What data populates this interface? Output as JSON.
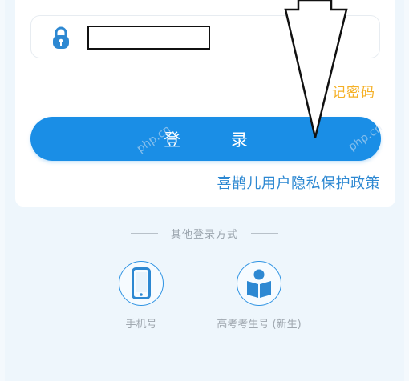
{
  "login_form": {
    "password_value": "",
    "forgot_password_label": "记密码",
    "login_button_label": "登 录",
    "privacy_link_label": "喜鹊儿用户隐私保护政策"
  },
  "other_login": {
    "divider_label": "其他登录方式",
    "methods": [
      {
        "label": "手机号",
        "icon": "phone-icon"
      },
      {
        "label": "高考考生号 (新生)",
        "icon": "reading-person-icon"
      }
    ]
  },
  "watermark": "php.cn",
  "colors": {
    "primary": "#1a8ee6",
    "accent_orange": "#f5b025",
    "link_blue": "#2d88d2",
    "muted_text": "#9aa4ad"
  }
}
